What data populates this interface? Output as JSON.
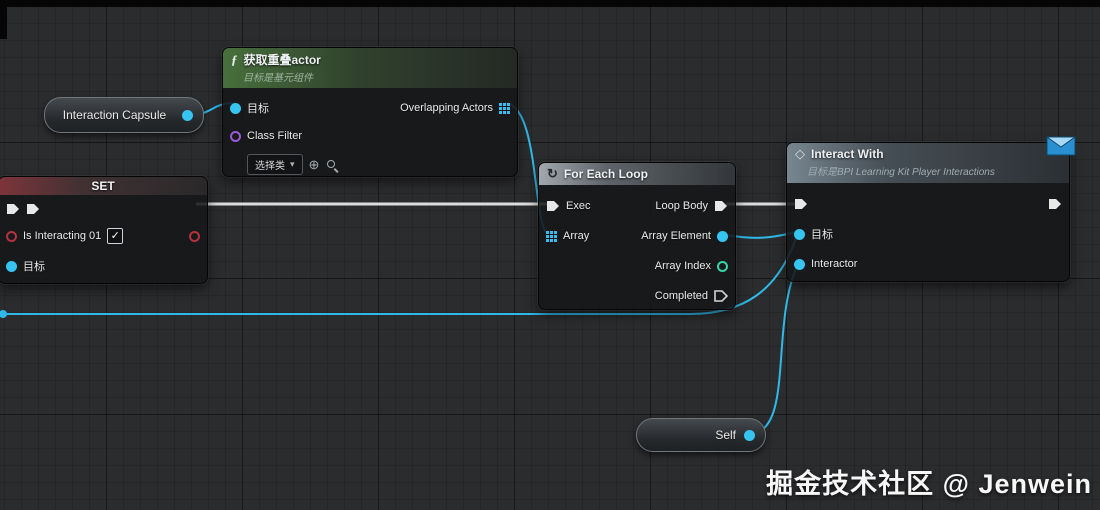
{
  "watermark": {
    "text": "掘金技术社区 @ Jenwein"
  },
  "icons": {
    "fn": "ƒ",
    "loop": "↻",
    "interface": "◇",
    "chevron_down": "▾",
    "pick": "⊕",
    "check": "✓"
  },
  "colors": {
    "exec_wire": "#dcdcdc",
    "data_wire": "#2fb9e8",
    "object_pin": "#35c5f0",
    "bool_pin": "#b5323e",
    "int_pin": "#35d5a8",
    "class_pin": "#9a5ad6"
  },
  "pills": {
    "interaction_capsule": {
      "label": "Interaction Capsule"
    },
    "self": {
      "label": "Self"
    }
  },
  "get_overlapping_node": {
    "title": "获取重叠actor",
    "subtitle": "目标是基元组件",
    "pins": {
      "target": "目标",
      "overlapping_actors": "Overlapping Actors",
      "class_filter": "Class Filter"
    },
    "class_dropdown": {
      "label": "选择类"
    }
  },
  "set_node": {
    "title": "SET",
    "pins": {
      "is_interacting": "Is Interacting 01",
      "target": "目标"
    },
    "is_interacting_checked": true
  },
  "foreach_node": {
    "title": "For Each Loop",
    "pins": {
      "exec": "Exec",
      "array": "Array",
      "loop_body": "Loop Body",
      "array_element": "Array Element",
      "array_index": "Array Index",
      "completed": "Completed"
    }
  },
  "interact_node": {
    "title": "Interact With",
    "subtitle": "目标是BPI Learning Kit Player Interactions",
    "pins": {
      "target": "目标",
      "interactor": "Interactor"
    }
  }
}
